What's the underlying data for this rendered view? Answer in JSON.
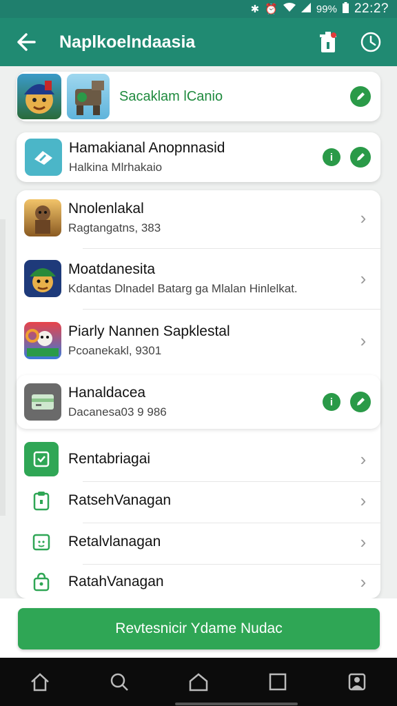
{
  "status_bar": {
    "battery": "99%",
    "time": "22:2?"
  },
  "app_bar": {
    "title": "Naplkoelndaasia"
  },
  "cards": {
    "top_label": "Sacaklam lCanio",
    "item2": {
      "title": "Hamakianal Anopnnasid",
      "subtitle": "Halkina Mlrhakaio"
    },
    "list": [
      {
        "title": "Nnolenlakal",
        "subtitle": "Ragtangatns, 383"
      },
      {
        "title": "Moatdanesita",
        "subtitle": "Kdantas Dlnadel Batarg ga Mlalan Hinlelkat."
      },
      {
        "title": "Piarly Nannen Sapklestal",
        "subtitle": "Pcoanekakl, 9301"
      }
    ],
    "item6": {
      "title": "Hanaldacea",
      "subtitle": "Dacanesa03 9 986"
    }
  },
  "menu": [
    {
      "label": "Rentabriagai",
      "icon": "document-check-icon"
    },
    {
      "label": "RatsehVanagan",
      "icon": "clipboard-icon"
    },
    {
      "label": "Retalvlanagan",
      "icon": "calendar-face-icon"
    },
    {
      "label": "RatahVanagan",
      "icon": "lock-bag-icon"
    }
  ],
  "cta_label": "Revtesnicir Ydame Nudac",
  "colors": {
    "primary": "#208a72",
    "status": "#1f7f6d",
    "accent": "#2fa655",
    "check": "#2a9a48"
  }
}
